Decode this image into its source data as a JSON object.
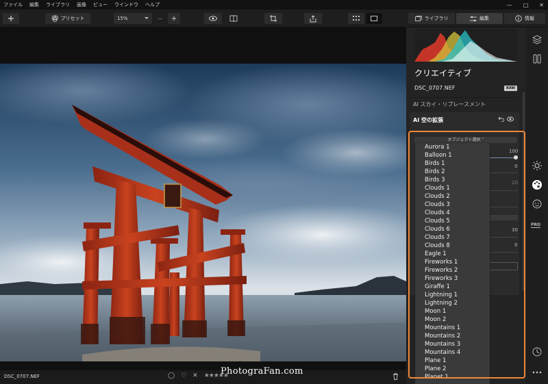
{
  "menu": [
    "ファイル",
    "編集",
    "ライブラリ",
    "画像",
    "ビュー",
    "ウインドウ",
    "ヘルプ"
  ],
  "window_controls": [
    "—",
    "□",
    "✕"
  ],
  "toolbar": {
    "preset_label": "プリセット",
    "zoom_value": "15%",
    "zoom_out": "—",
    "zoom_in": "+",
    "library_tab": "ライブラリ",
    "edit_tab": "編集",
    "info_tab": "情報"
  },
  "bottom": {
    "filename": "DSC_0707.NEF",
    "rating": "★★★★★",
    "watermark": "PhotograFan.com"
  },
  "panel": {
    "title": "クリエイティブ",
    "filename": "DSC_0707.NEF",
    "raw_badge": "RAW",
    "sky_replacement": "AI スカイ・リプレースメント",
    "sky_extension": "AI 空の拡張",
    "object_select": "オブジェクト選択",
    "values": [
      "100",
      "0",
      "20",
      "30",
      "0"
    ]
  },
  "dropdown": {
    "items": [
      "Aurora 1",
      "Balloon 1",
      "Birds 1",
      "Birds 2",
      "Birds 3",
      "Clouds 1",
      "Clouds 2",
      "Clouds 3",
      "Clouds 4",
      "Clouds 5",
      "Clouds 6",
      "Clouds 7",
      "Clouds 8",
      "Eagle 1",
      "Fireworks 1",
      "Fireworks 2",
      "Fireworks 3",
      "Giraffe 1",
      "Lightning 1",
      "Lightning 2",
      "Moon 1",
      "Moon 2",
      "Mountains 1",
      "Mountains 2",
      "Mountains 3",
      "Mountains 4",
      "Plane 1",
      "Plane 2",
      "Planet 1"
    ]
  },
  "colors": {
    "accent_highlight": "#f0883a",
    "panel_bg": "#232323",
    "dropdown_bg": "#3a3a3a"
  }
}
